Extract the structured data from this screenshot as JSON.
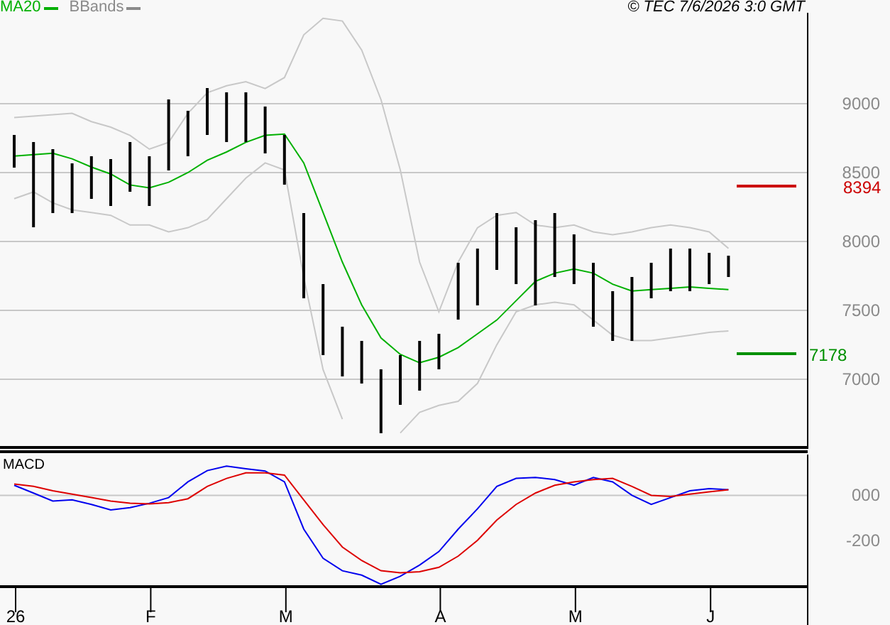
{
  "legend": [
    {
      "label": "MA20",
      "color": "#00b000"
    },
    {
      "label": "BBands",
      "color": "#8a8a8a"
    }
  ],
  "copyright": "© TEC 7/6/2026 3:0 GMT",
  "price_chart": {
    "chart_data": {
      "type": "line",
      "grid": true,
      "series": [
        {
          "color": "#00b000",
          "values": [
            8620,
            8630,
            8640,
            8600,
            8540,
            8490,
            8410,
            8390,
            8430,
            8500,
            8590,
            8650,
            8720,
            8770,
            8780,
            8570,
            8210,
            7850,
            7540,
            7300,
            7180,
            7120,
            7160,
            7230,
            7330,
            7430,
            7570,
            7710,
            7770,
            7800,
            7770,
            7690,
            7640,
            7650,
            7660,
            7670,
            7660,
            7650
          ]
        },
        {
          "color": "#c8c8c8",
          "values": [
            8900,
            8910,
            8920,
            8930,
            8870,
            8830,
            8770,
            8670,
            8720,
            8930,
            9080,
            9130,
            9160,
            9110,
            9190,
            9500,
            9620,
            9600,
            9390,
            9030,
            8520,
            7850,
            7490,
            7850,
            8100,
            8190,
            8210,
            8120,
            8100,
            8120,
            8070,
            8050,
            8070,
            8100,
            8120,
            8100,
            8070,
            7950
          ]
        },
        {
          "color": "#c8c8c8",
          "values": [
            8310,
            8360,
            8280,
            8230,
            8210,
            8190,
            8120,
            8120,
            8070,
            8100,
            8160,
            8310,
            8460,
            8570,
            8520,
            7740,
            7070,
            6710,
            null,
            null,
            6610,
            6760,
            6810,
            6840,
            6970,
            7250,
            7490,
            7540,
            7560,
            7540,
            7430,
            7320,
            7280,
            7280,
            7300,
            7320,
            7340,
            7350
          ]
        }
      ],
      "ylim": [
        6505,
        9660
      ],
      "yticks": [
        {
          "value": 7000,
          "label": "7000"
        },
        {
          "value": 7500,
          "label": "7500"
        },
        {
          "value": 8000,
          "label": "8000"
        },
        {
          "value": 8500,
          "label": "8500"
        },
        {
          "value": 9000,
          "label": "9000"
        }
      ]
    },
    "levels": [
      {
        "label": "8394",
        "color": "#cc0000"
      },
      {
        "label": "7178",
        "color": "#009000"
      }
    ]
  },
  "macd_chart": {
    "chart_data": {
      "type": "line",
      "title": "MACD",
      "grid": true,
      "categories": [
        "26",
        null,
        null,
        null,
        null,
        null,
        null,
        "F",
        null,
        null,
        null,
        null,
        null,
        null,
        "M",
        null,
        null,
        null,
        null,
        null,
        null,
        null,
        "A",
        null,
        null,
        null,
        null,
        null,
        null,
        "M",
        null,
        null,
        null,
        null,
        null,
        null,
        "J",
        null
      ],
      "series": [
        {
          "color": "#0000ee",
          "values": [
            45,
            10,
            -25,
            -20,
            -40,
            -65,
            -55,
            -35,
            -10,
            60,
            110,
            130,
            118,
            108,
            60,
            -150,
            -280,
            -335,
            -355,
            -395,
            -360,
            -310,
            -250,
            -150,
            -60,
            40,
            75,
            80,
            70,
            45,
            80,
            60,
            0,
            -40,
            -10,
            20,
            30,
            25
          ]
        },
        {
          "color": "#dd0000",
          "values": [
            50,
            40,
            20,
            5,
            -10,
            -25,
            -35,
            -38,
            -33,
            -15,
            40,
            75,
            100,
            100,
            90,
            -20,
            -130,
            -230,
            -290,
            -335,
            -345,
            -340,
            -320,
            -270,
            -200,
            -110,
            -40,
            10,
            45,
            60,
            70,
            75,
            40,
            0,
            -5,
            5,
            15,
            25
          ]
        }
      ],
      "ylim": [
        -406,
        194
      ],
      "yticks": [
        {
          "value": 0,
          "label": "000"
        },
        {
          "value": -200,
          "label": "-200"
        }
      ]
    }
  }
}
